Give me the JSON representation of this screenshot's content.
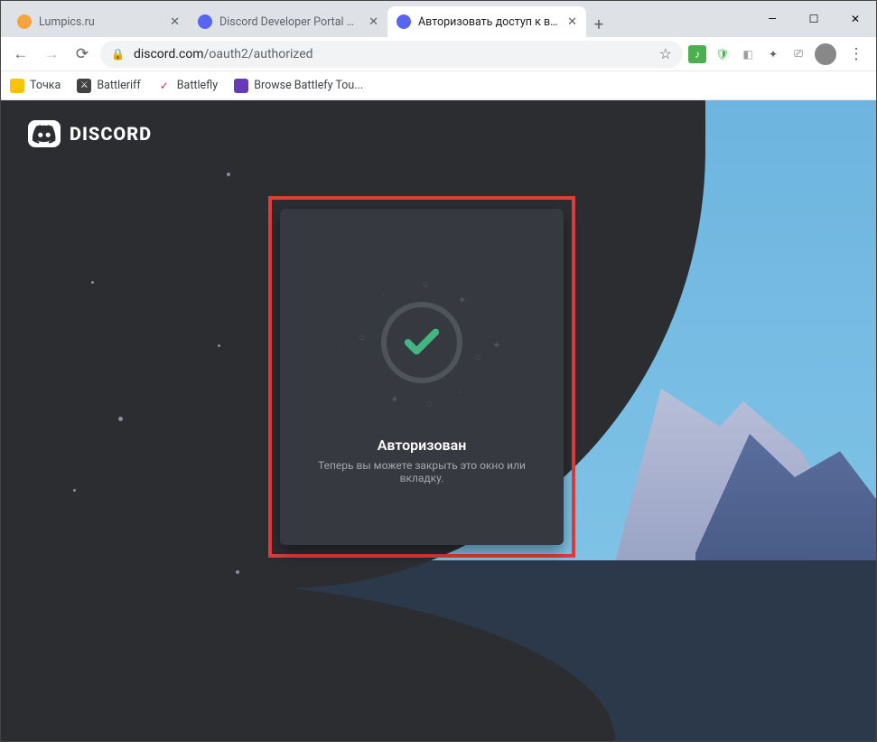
{
  "window": {
    "tabs": [
      {
        "title": "Lumpics.ru",
        "active": false
      },
      {
        "title": "Discord Developer Portal — M",
        "active": false
      },
      {
        "title": "Авторизовать доступ к ваше",
        "active": true
      }
    ]
  },
  "address": {
    "host": "discord.com",
    "path": "/oauth2/authorized"
  },
  "bookmarks": [
    {
      "label": "Точка"
    },
    {
      "label": "Battleriff"
    },
    {
      "label": "Battlefly"
    },
    {
      "label": "Browse Battlefy Tou..."
    }
  ],
  "brand": {
    "name": "DISCORD"
  },
  "card": {
    "title": "Авторизован",
    "subtitle": "Теперь вы можете закрыть это окно или вкладку."
  }
}
